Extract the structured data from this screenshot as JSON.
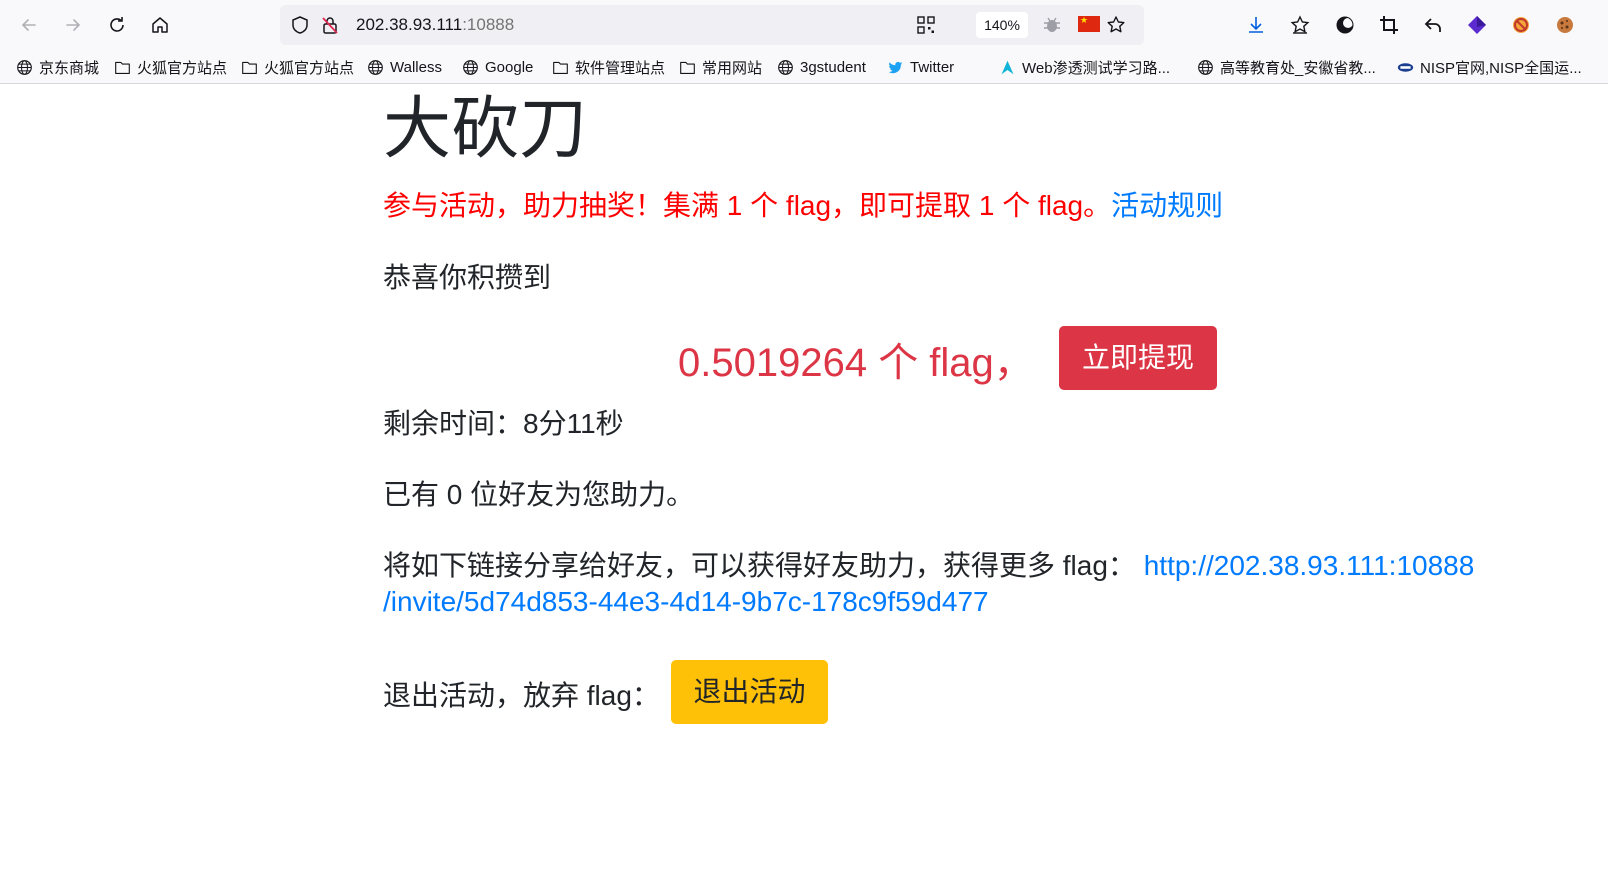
{
  "browser": {
    "url_host": "202.38.93.111",
    "url_port": ":10888",
    "zoom": "140%",
    "accent_color": "#0060df",
    "bookmarks": [
      {
        "label": "京东商城",
        "icon": "globe-icon"
      },
      {
        "label": "火狐官方站点",
        "icon": "folder-icon"
      },
      {
        "label": "火狐官方站点",
        "icon": "folder-icon"
      },
      {
        "label": "Walless",
        "icon": "globe-icon"
      },
      {
        "label": "Google",
        "icon": "globe-icon"
      },
      {
        "label": "软件管理站点",
        "icon": "folder-icon"
      },
      {
        "label": "常用网站",
        "icon": "folder-icon"
      },
      {
        "label": "3gstudent",
        "icon": "globe-icon"
      },
      {
        "label": "Twitter",
        "icon": "twitter-icon"
      },
      {
        "label": "Web渗透测试学习路...",
        "icon": "arrow-logo-icon"
      },
      {
        "label": "高等教育处_安徽省教...",
        "icon": "globe-icon"
      },
      {
        "label": "NISP官网,NISP全国运...",
        "icon": "nisp-icon"
      }
    ]
  },
  "page": {
    "title": "大砍刀",
    "lead_text": "参与活动，助力抽奖！集满 1 个 flag，即可提取 1 个 flag。",
    "rules_link": "活动规则",
    "congrats": "恭喜你积攒到",
    "amount": "0.5019264 个 flag，",
    "withdraw_button": "立即提现",
    "remaining_time": "剩余时间：8分11秒",
    "friends_helped": "已有 0 位好友为您助力。",
    "share_text": "将如下链接分享给好友，可以获得好友助力，获得更多 flag：",
    "share_link_line1": "http://202.38.93.111:10888",
    "share_link_line2": "/invite/5d74d853-44e3-4d14-9b7c-178c9f59d477",
    "quit_text": "退出活动，放弃 flag：",
    "quit_button": "退出活动",
    "colors": {
      "danger": "#dc3545",
      "warning": "#ffc107",
      "link": "#007bff",
      "lead": "#ff0000"
    }
  }
}
